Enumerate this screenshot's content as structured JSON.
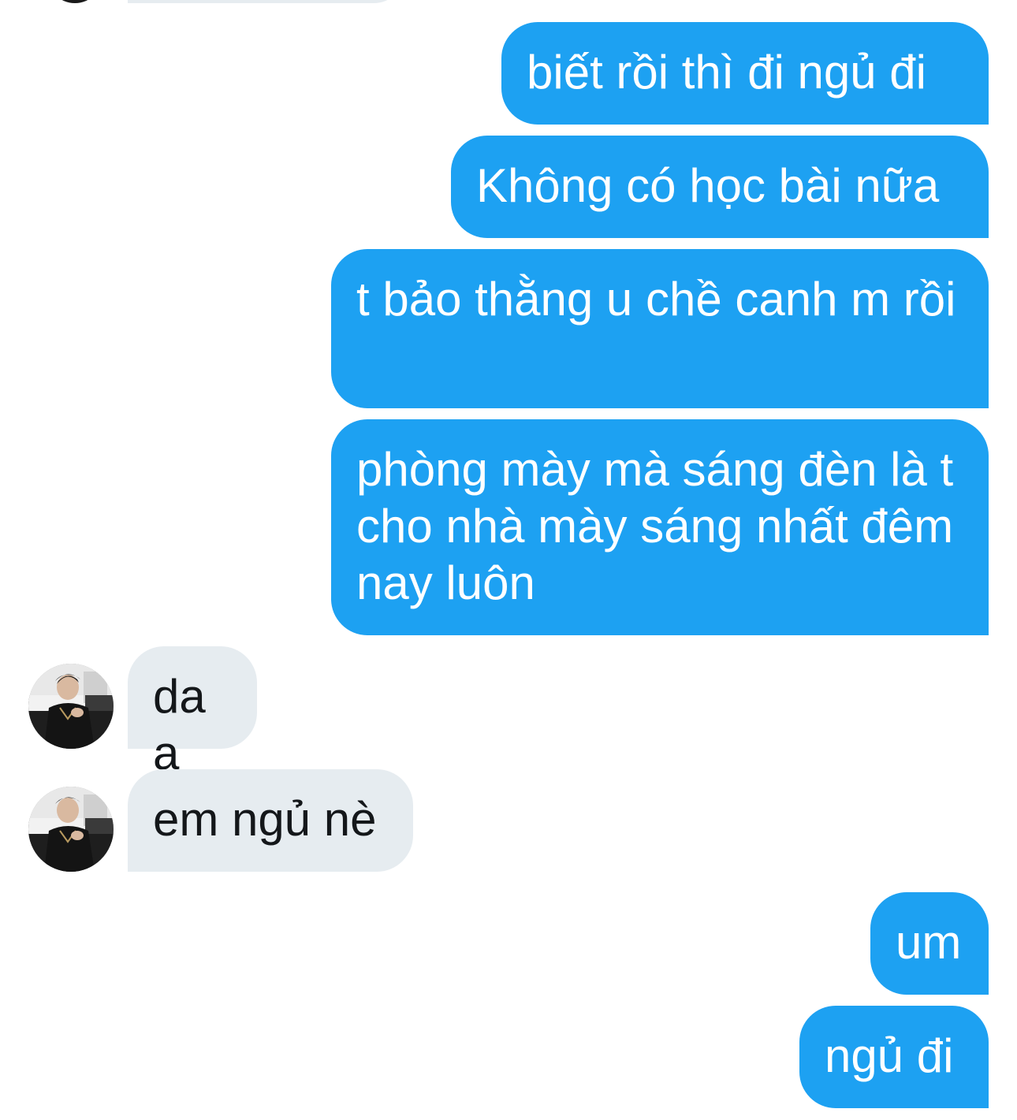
{
  "messages": [
    {
      "from": "me",
      "text": "biết rồi thì đi ngủ đi"
    },
    {
      "from": "me",
      "text": "Không có học bài nữa"
    },
    {
      "from": "me",
      "text": "t bảo thằng u chề canh m rồi"
    },
    {
      "from": "me",
      "text": "phòng mày mà sáng đèn là t cho nhà mày sáng nhất đêm nay luôn"
    },
    {
      "from": "them",
      "text": "daa"
    },
    {
      "from": "them",
      "text": "em ngủ nè"
    },
    {
      "from": "me",
      "text": "um"
    },
    {
      "from": "me",
      "text": "ngủ đi"
    }
  ],
  "colors": {
    "sent_bubble": "#1da1f2",
    "received_bubble": "#e6ecf0",
    "sent_text": "#ffffff",
    "received_text": "#14171a"
  }
}
